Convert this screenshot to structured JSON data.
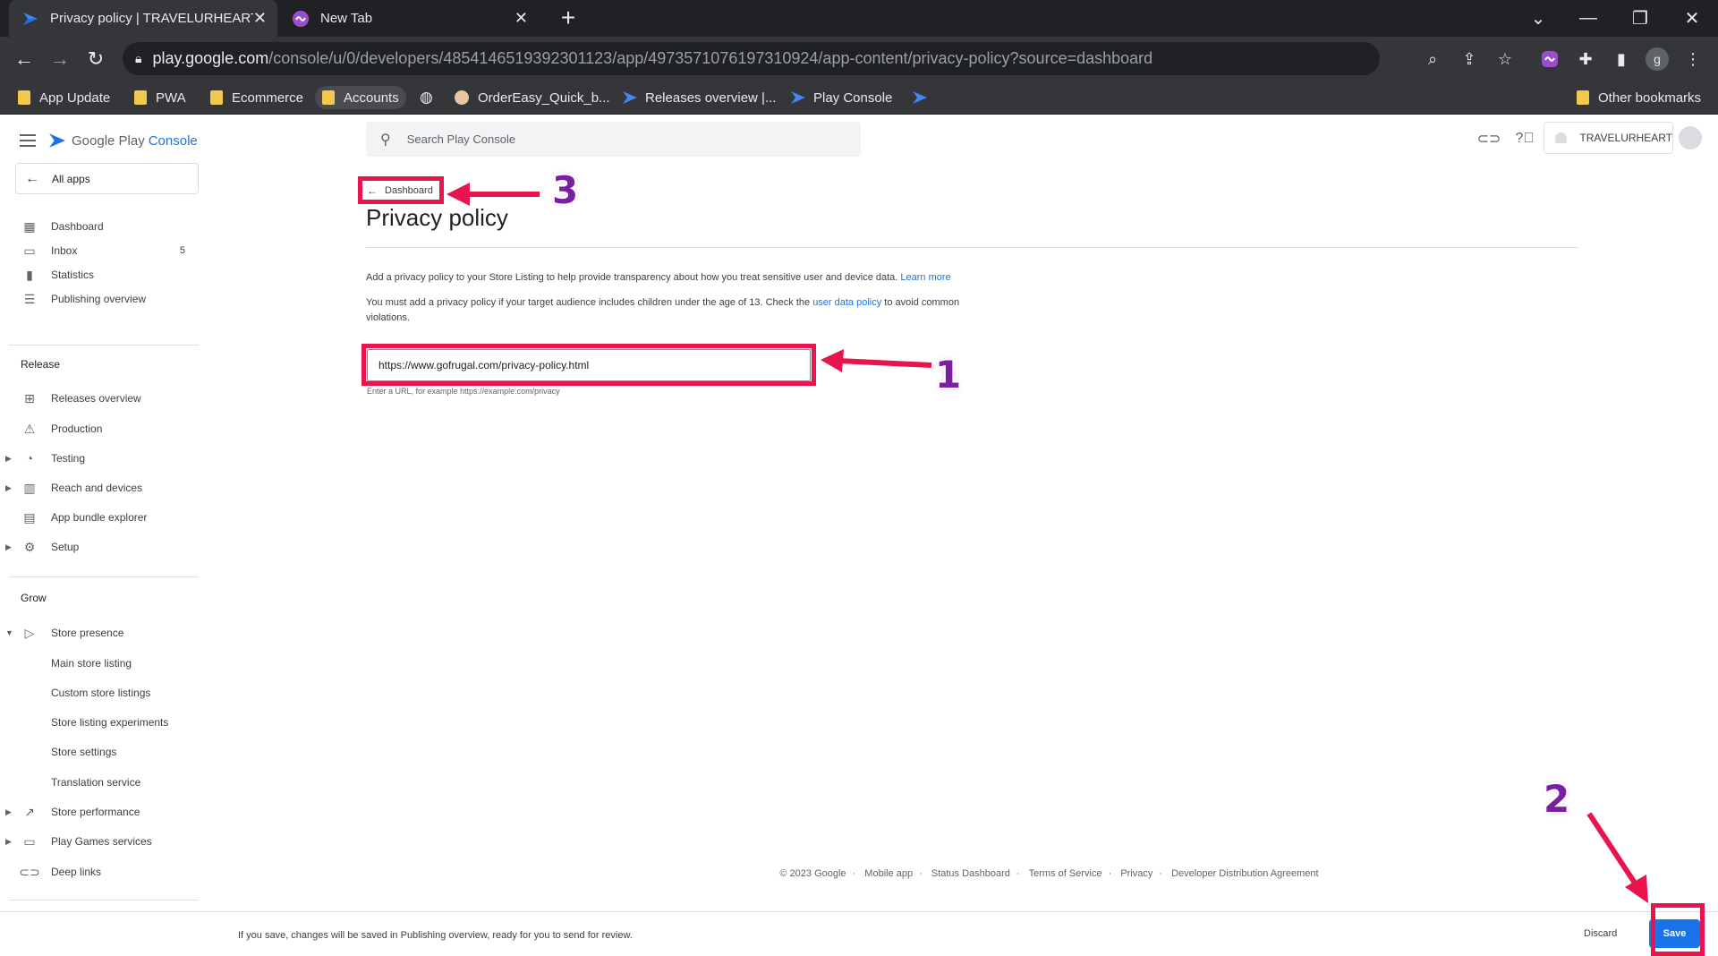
{
  "browser": {
    "tabs": [
      {
        "title": "Privacy policy | TRAVELURHEART",
        "active": true
      },
      {
        "title": "New Tab",
        "active": false
      }
    ],
    "url_host": "play.google.com",
    "url_path": "/console/u/0/developers/4854146519392301123/app/4973571076197310924/app-content/privacy-policy?source=dashboard",
    "profile_initial": "g"
  },
  "bookmarks": [
    "App Update",
    "PWA",
    "Ecommerce",
    "Accounts",
    "OrderEasy_Quick_b...",
    "Releases overview |...",
    "Play Console",
    "Other bookmarks"
  ],
  "sidebar": {
    "logo_google_play": "Google Play",
    "logo_console": "Console",
    "all_apps": "All apps",
    "top_items": [
      {
        "label": "Dashboard",
        "icon": "dashboard-icon"
      },
      {
        "label": "Inbox",
        "icon": "inbox-icon",
        "badge": "5"
      },
      {
        "label": "Statistics",
        "icon": "statistics-icon"
      },
      {
        "label": "Publishing overview",
        "icon": "publishing-icon"
      }
    ],
    "release_title": "Release",
    "release_items": [
      {
        "label": "Releases overview",
        "icon": "releases-icon"
      },
      {
        "label": "Production",
        "icon": "production-icon"
      },
      {
        "label": "Testing",
        "icon": "testing-icon"
      },
      {
        "label": "Reach and devices",
        "icon": "reach-icon"
      },
      {
        "label": "App bundle explorer",
        "icon": "bundle-icon"
      },
      {
        "label": "Setup",
        "icon": "setup-icon"
      }
    ],
    "grow_title": "Grow",
    "grow_items": [
      {
        "label": "Store presence",
        "icon": "store-presence-icon"
      },
      {
        "label": "Main store listing"
      },
      {
        "label": "Custom store listings"
      },
      {
        "label": "Store listing experiments"
      },
      {
        "label": "Store settings"
      },
      {
        "label": "Translation service"
      },
      {
        "label": "Store performance",
        "icon": "trending-icon"
      },
      {
        "label": "Play Games services",
        "icon": "gamepad-icon"
      },
      {
        "label": "Deep links",
        "icon": "link-icon"
      }
    ]
  },
  "header": {
    "search_placeholder": "Search Play Console",
    "account_name": "TRAVELURHEART"
  },
  "main": {
    "breadcrumb": "Dashboard",
    "title": "Privacy policy",
    "desc1": "Add a privacy policy to your Store Listing to help provide transparency about how you treat sensitive user and device data.",
    "desc1_link": "Learn more",
    "desc2_a": "You must add a privacy policy if your target audience includes children under the age of 13. Check the",
    "desc2_link": "user data policy",
    "desc2_b": "to avoid common",
    "desc2_c": "violations.",
    "url_value": "https://www.gofrugal.com/privacy-policy.html",
    "url_helper": "Enter a URL, for example https://example.com/privacy"
  },
  "annotations": {
    "n1": "1",
    "n2": "2",
    "n3": "3",
    "color": "#e8144e"
  },
  "footer": [
    "© 2023 Google",
    "Mobile app",
    "Status Dashboard",
    "Terms of Service",
    "Privacy",
    "Developer Distribution Agreement"
  ],
  "savebar": {
    "message": "If you save, changes will be saved in Publishing overview, ready for you to send for review.",
    "discard": "Discard",
    "save": "Save"
  }
}
